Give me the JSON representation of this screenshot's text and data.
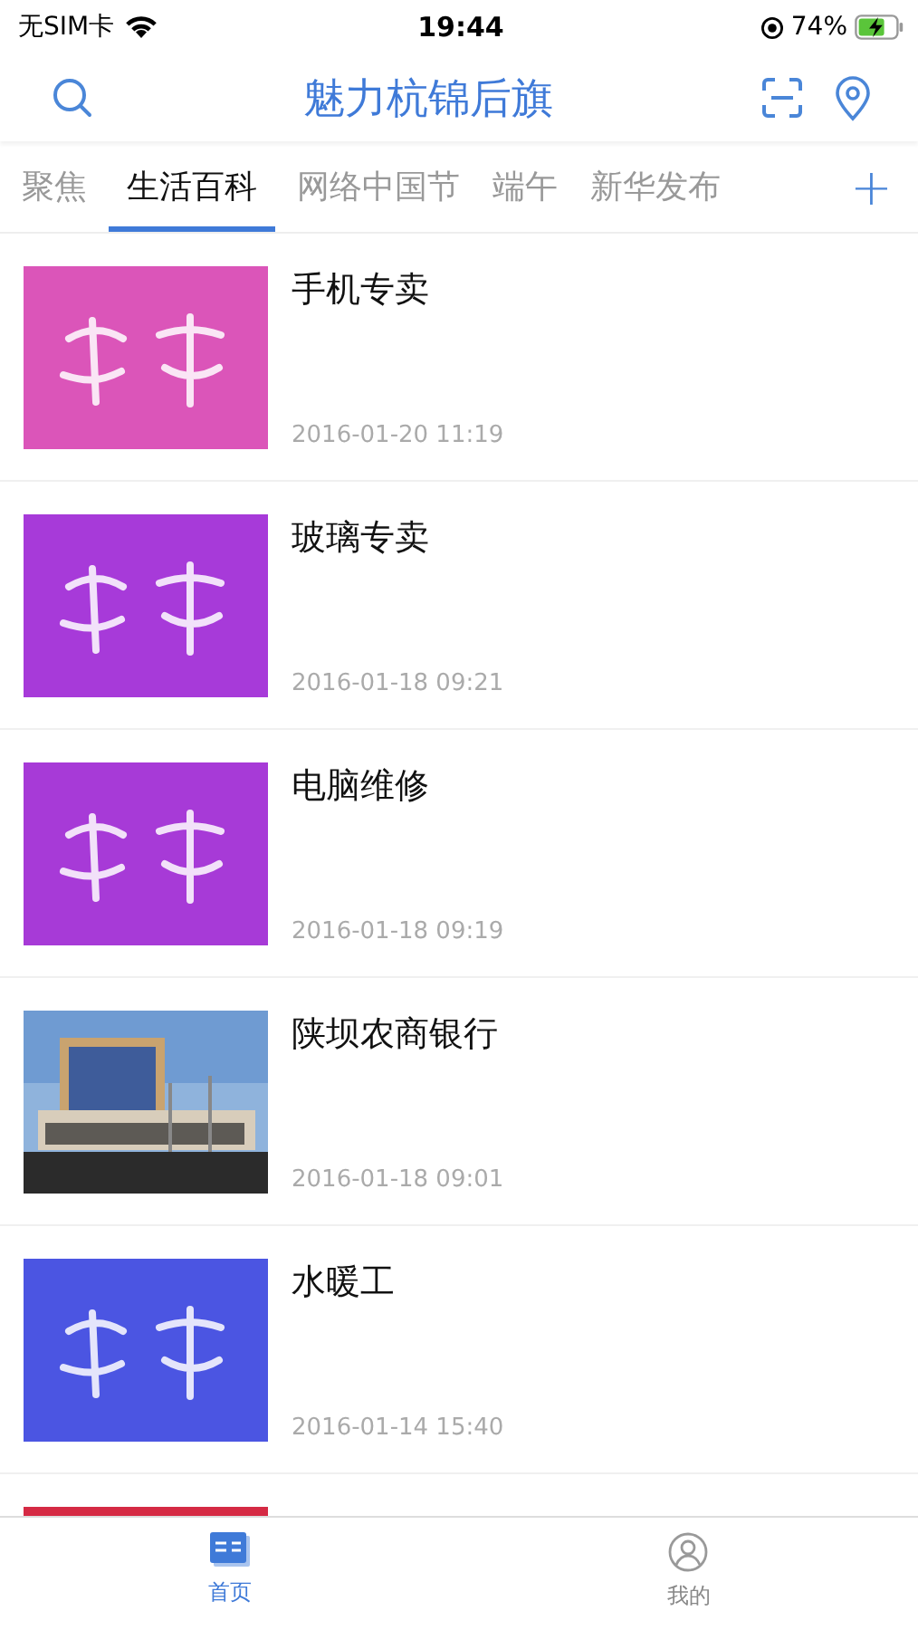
{
  "status_bar": {
    "carrier": "无SIM卡",
    "time": "19:44",
    "battery": "74%"
  },
  "header": {
    "title": "魅力杭锦后旗"
  },
  "channels": [
    {
      "label": "聚焦",
      "selected": false
    },
    {
      "label": "生活百科",
      "selected": true
    },
    {
      "label": "网络中国节",
      "selected": false
    },
    {
      "label": "端午",
      "selected": false
    },
    {
      "label": "新华发布",
      "selected": false
    }
  ],
  "add_button": "+",
  "articles": [
    {
      "title": "手机专卖",
      "date": "2016-01-20 11:19",
      "thumbnail": {
        "kind": "picture"
      }
    },
    {
      "title": "玻璃专卖",
      "date": "2016-01-18 09:21",
      "thumbnail": {
        "kind": "picture"
      }
    },
    {
      "title": "电脑维修",
      "date": "2016-01-18 09:19",
      "thumbnail": {
        "kind": "picture"
      }
    },
    {
      "title": "陕坝农商银行",
      "date": "2016-01-18 09:01",
      "thumbnail": {
        "kind": "picture"
      }
    },
    {
      "title": "水暖工",
      "date": "2016-01-14 15:40",
      "thumbnail": {
        "kind": "picture"
      }
    },
    {
      "thumbnail": {
        "kind": "picture"
      }
    }
  ],
  "tab_bar": [
    {
      "label": "首页",
      "selected": true
    },
    {
      "label": "我的",
      "selected": false
    }
  ]
}
